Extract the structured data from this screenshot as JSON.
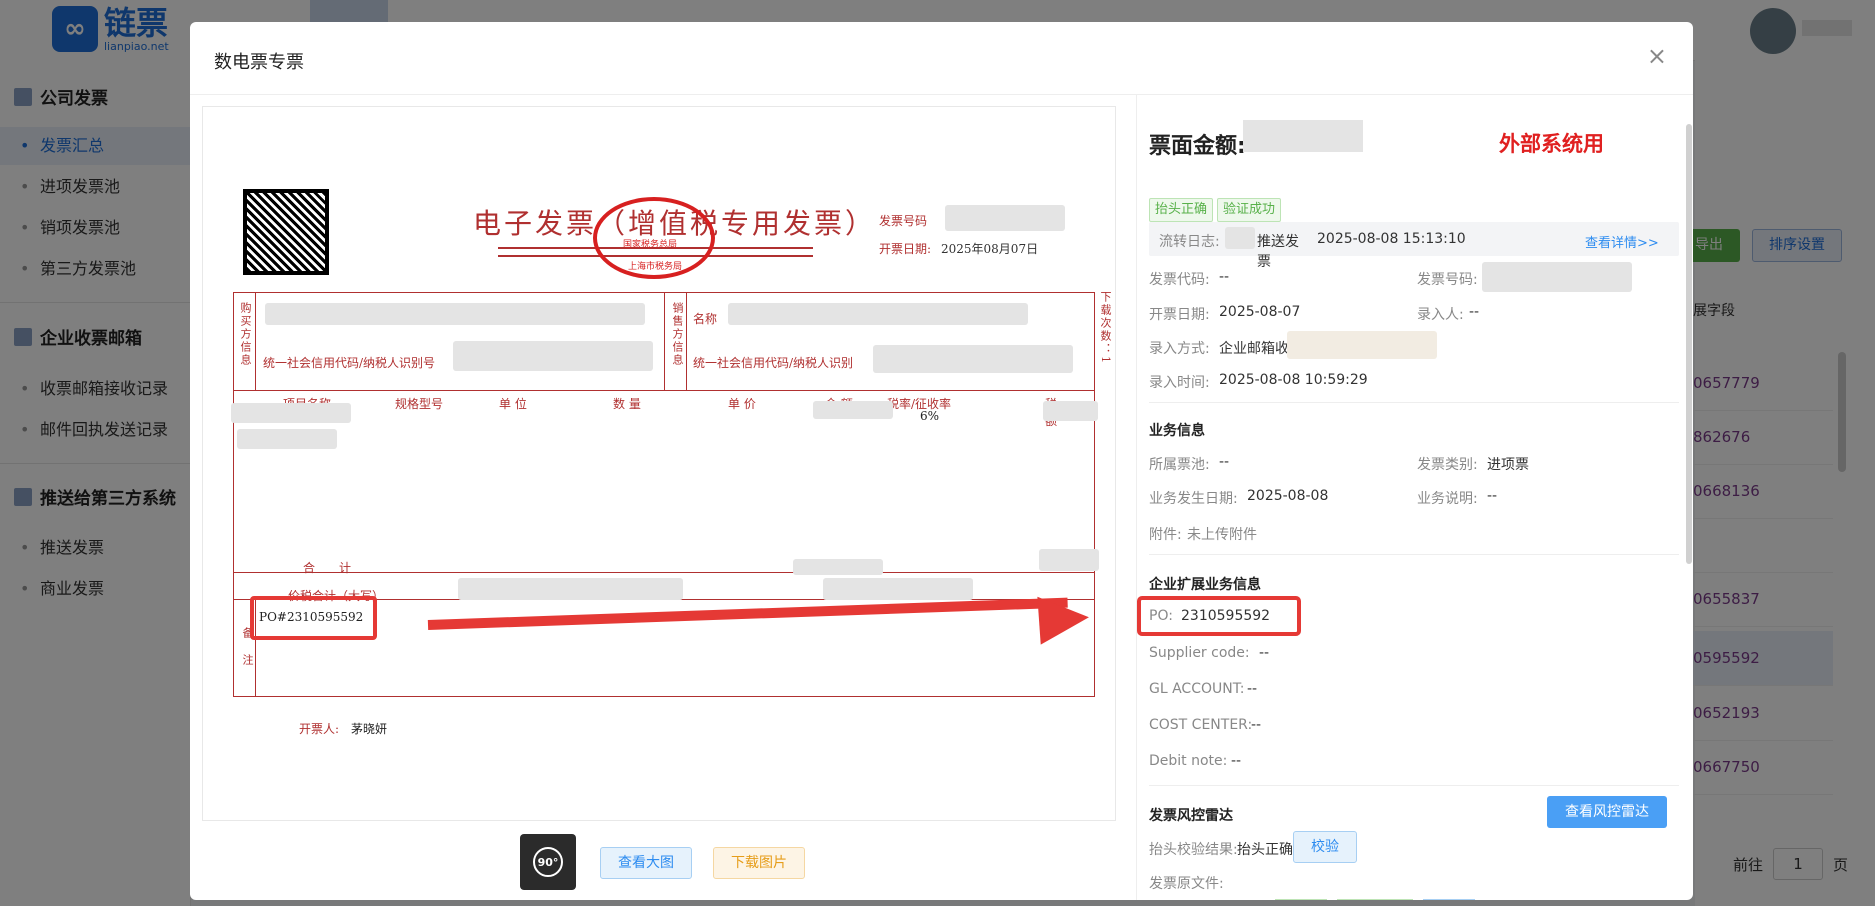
{
  "app": {
    "logo_mark": "∞",
    "logo_cn": "链票",
    "logo_en": "lianpiao.net"
  },
  "sidebar": {
    "sections": [
      {
        "title": "公司发票",
        "items": [
          "发票汇总",
          "进项发票池",
          "销项发票池",
          "第三方发票池"
        ]
      },
      {
        "title": "企业收票邮箱",
        "items": [
          "收票邮箱接收记录",
          "邮件回执发送记录"
        ]
      },
      {
        "title": "推送给第三方系统",
        "items": [
          "推送发票",
          "商业发票"
        ]
      }
    ]
  },
  "background": {
    "export_label": "导出",
    "sort_label": "排序设置",
    "column_header": "展字段",
    "rows": [
      "0657779",
      "862676",
      "0668136",
      "",
      "0655837",
      "0595592",
      "0652193",
      "0667750"
    ],
    "pager_before": "前往",
    "pager_value": "1",
    "pager_after": "页"
  },
  "modal": {
    "title": "数电票专票",
    "close": "×"
  },
  "invoice": {
    "title": "电子发票（增值税专用发票）",
    "number_label": "发票号码",
    "date_label": "开票日期:",
    "date_value": "2025年08月07日",
    "seal_top": "国家税务总局",
    "seal_bottom": "上海市税务局",
    "buyer_side": "购买方信息",
    "seller_side": "销售方信息",
    "seller_name_label": "名称",
    "credit_code_label": "统一社会信用代码/纳税人识别号",
    "credit_code_label_seller": "统一社会信用代码/纳税人识别",
    "col_item": "项目名称",
    "col_spec": "规格型号",
    "col_unit": "单 位",
    "col_qty": "数 量",
    "col_price": "单 价",
    "col_amount": "金 额",
    "col_rate": "税率/征收率",
    "rate_value": "6%",
    "col_tax_cut": "税 额",
    "total_label": "合　　计",
    "total_words_label": "价税合计（大写）",
    "remark_label": "备注",
    "po_value": "PO#2310595592",
    "issuer_label": "开票人:",
    "issuer_value": "茅晓妍",
    "download_vertical": "下载次数：1"
  },
  "viewer_toolbar": {
    "rotate_label": "90°",
    "view_large": "查看大图",
    "download_image": "下载图片"
  },
  "details": {
    "amount_label": "票面金额:",
    "external_tag": "外部系统用",
    "tags": [
      "抬头正确",
      "验证成功"
    ],
    "log_label": "流转日志:",
    "log_action": "推送发票",
    "log_time": "2025-08-08 15:13:10",
    "log_link": "查看详情>>",
    "invoice_code_label": "发票代码:",
    "invoice_code_value": "--",
    "invoice_number_label": "发票号码:",
    "issue_date_label": "开票日期:",
    "issue_date_value": "2025-08-07",
    "entry_person_label": "录入人:",
    "entry_person_value": "--",
    "entry_method_label": "录入方式:",
    "entry_method_value": "企业邮箱收",
    "entry_time_label": "录入时间:",
    "entry_time_value": "2025-08-08 10:59:29",
    "business_section": "业务信息",
    "pool_label": "所属票池:",
    "pool_value": "--",
    "type_label": "发票类别:",
    "type_value": "进项票",
    "biz_date_label": "业务发生日期:",
    "biz_date_value": "2025-08-08",
    "biz_desc_label": "业务说明:",
    "biz_desc_value": "--",
    "attachment_label": "附件:",
    "attachment_value": "未上传附件",
    "ext_section": "企业扩展业务信息",
    "po_label": "PO:",
    "po_value": "2310595592",
    "supplier_label": "Supplier code:",
    "supplier_value": "--",
    "gl_label": "GL ACCOUNT:",
    "gl_value": "--",
    "cost_label": "COST CENTER:",
    "cost_value": "--",
    "debit_label": "Debit note:",
    "debit_value": "--",
    "risk_section": "发票风控雷达",
    "risk_button": "查看风控雷达",
    "header_check_label": "抬头校验结果:",
    "header_check_value": "抬头正确",
    "check_button": "校验",
    "original_file_label": "发票原文件:"
  },
  "colors": {
    "brand": "#1e6fd9",
    "invoice_red": "#b03030",
    "highlight_red": "#e53935",
    "tag_green": "#58b14a",
    "link_blue": "#2d8cf0"
  }
}
